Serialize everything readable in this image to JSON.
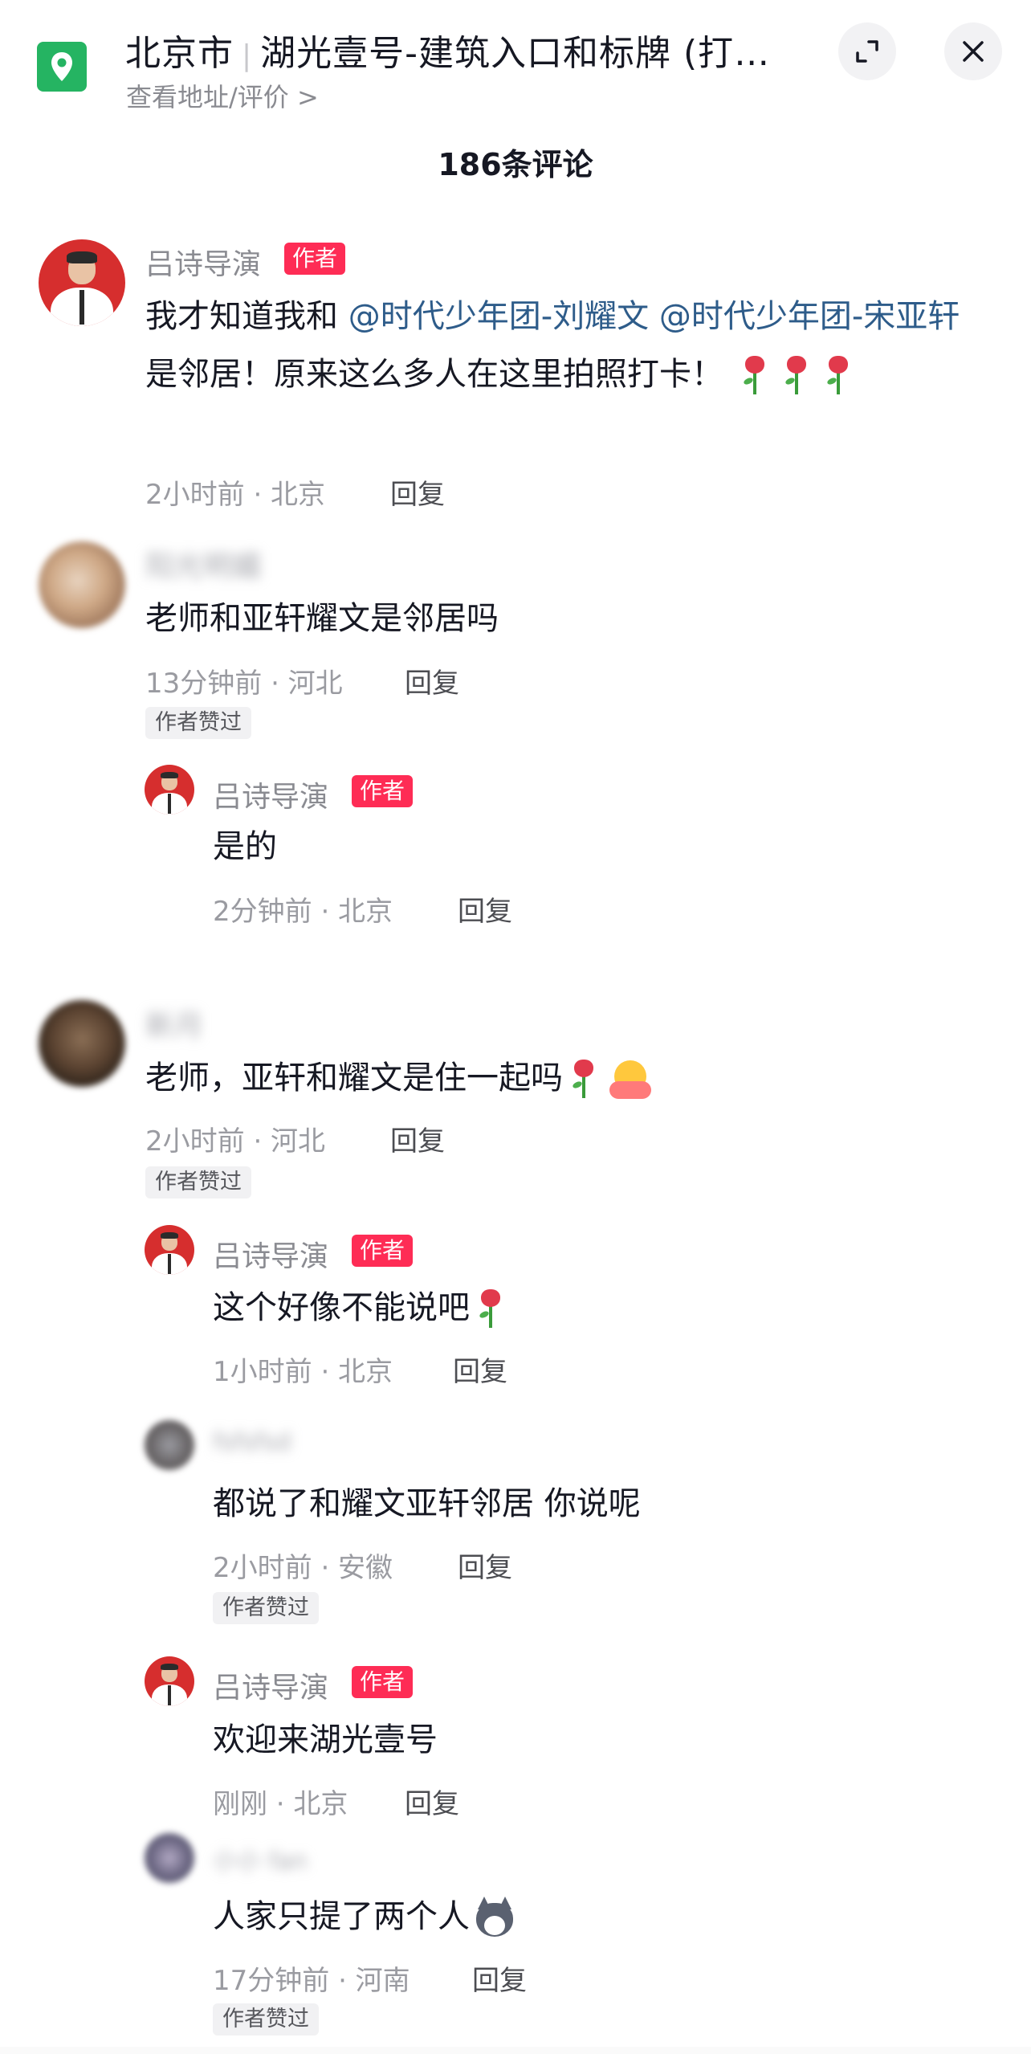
{
  "header": {
    "city": "北京市",
    "place": "湖光壹号-建筑入口和标牌 (打…",
    "sub_link": "查看地址/评价 >",
    "icons": {
      "location": "map-pin-icon",
      "expand": "expand-icon",
      "close": "close-icon"
    }
  },
  "comment_count": "186条评论",
  "author_tag": "作者",
  "reply_label": "回复",
  "author_liked": "作者赞过",
  "colors": {
    "author_tag": "#fe2c55",
    "mention": "#2e5c8a",
    "pin": "#25b462"
  },
  "comments": [
    {
      "user": "吕诗导演",
      "text_pre": "我才知道我和 ",
      "mention1": "@时代少年团-刘耀文",
      "mention2": " @时代少年团-宋亚轩",
      "text_post": " 是邻居！原来这么多人在这里拍照打卡！",
      "meta": "2小时前 · 北京"
    },
    {
      "user": "阳光明媚",
      "text": "老师和亚轩耀文是邻居吗",
      "meta": "13分钟前 · 河北",
      "reply": {
        "user": "吕诗导演",
        "text": "是的",
        "meta": "2分钟前 · 北京"
      }
    },
    {
      "user": "新月",
      "text": "老师，亚轩和耀文是住一起吗",
      "meta": "2小时前 · 河北",
      "replies": [
        {
          "user": "吕诗导演",
          "text": "这个好像不能说吧",
          "meta": "1小时前 · 北京"
        },
        {
          "user": "fsfsfsd",
          "text": "都说了和耀文亚轩邻居 你说呢",
          "meta": "2小时前 · 安徽"
        },
        {
          "user": "吕诗导演",
          "text": "欢迎来湖光壹号",
          "meta": "刚刚 · 北京"
        },
        {
          "user": "小小 fan",
          "text": "人家只提了两个人",
          "meta": "17分钟前 · 河南"
        }
      ]
    }
  ]
}
